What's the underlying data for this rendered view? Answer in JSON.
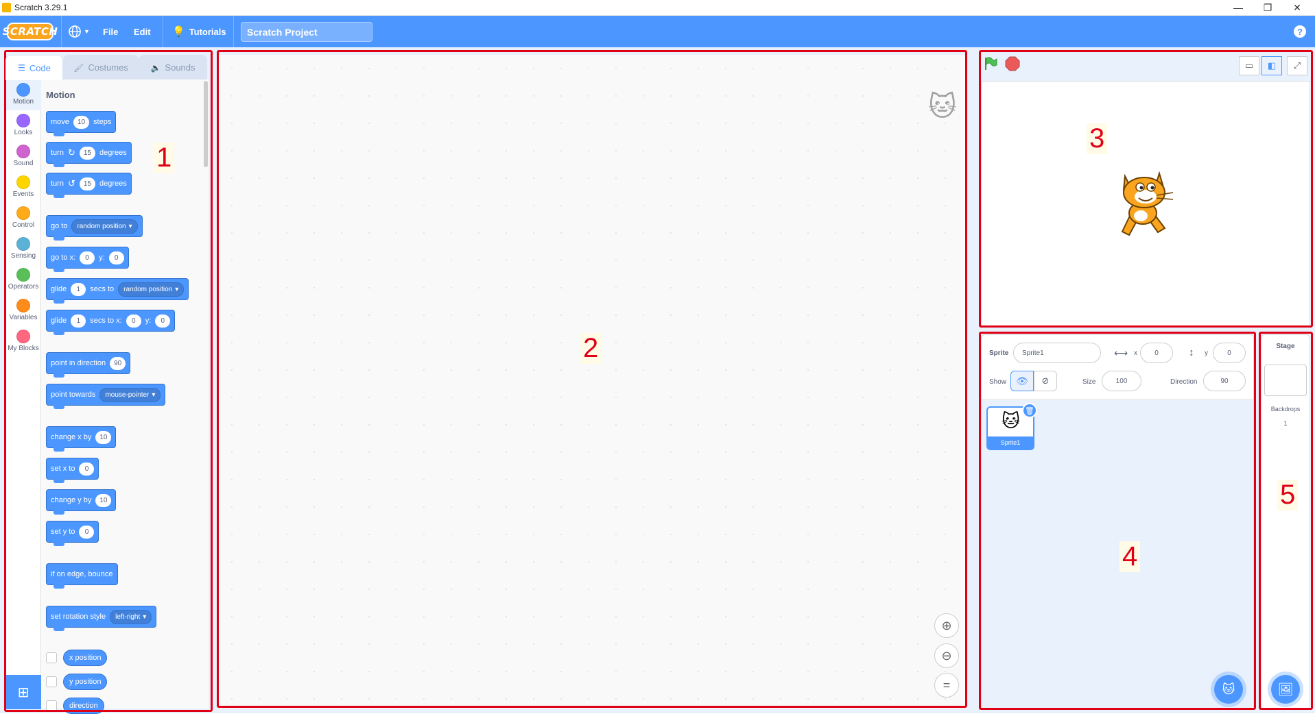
{
  "window": {
    "title": "Scratch 3.29.1",
    "minimize": "—",
    "restore": "❐",
    "close": "✕"
  },
  "menubar": {
    "logo": "SCRATCH",
    "file": "File",
    "edit": "Edit",
    "tutorials": "Tutorials",
    "project_title": "Scratch Project",
    "help": "?"
  },
  "tabs": {
    "code": "Code",
    "costumes": "Costumes",
    "sounds": "Sounds"
  },
  "categories": [
    {
      "label": "Motion",
      "color": "#4c97ff"
    },
    {
      "label": "Looks",
      "color": "#9966ff"
    },
    {
      "label": "Sound",
      "color": "#cf63cf"
    },
    {
      "label": "Events",
      "color": "#ffd500"
    },
    {
      "label": "Control",
      "color": "#ffab19"
    },
    {
      "label": "Sensing",
      "color": "#5cb1d6"
    },
    {
      "label": "Operators",
      "color": "#59c059"
    },
    {
      "label": "Variables",
      "color": "#ff8c1a"
    },
    {
      "label": "My Blocks",
      "color": "#ff6680"
    }
  ],
  "palette": {
    "section_title": "Motion",
    "move": {
      "a": "move",
      "v": "10",
      "b": "steps"
    },
    "turn_right": {
      "a": "turn",
      "v": "15",
      "b": "degrees"
    },
    "turn_left": {
      "a": "turn",
      "v": "15",
      "b": "degrees"
    },
    "go_to": {
      "a": "go to",
      "d": "random position"
    },
    "go_to_xy": {
      "a": "go to x:",
      "x": "0",
      "yl": "y:",
      "y": "0"
    },
    "glide_to": {
      "a": "glide",
      "v": "1",
      "b": "secs to",
      "d": "random position"
    },
    "glide_xy": {
      "a": "glide",
      "v": "1",
      "b": "secs to x:",
      "x": "0",
      "yl": "y:",
      "y": "0"
    },
    "point_dir": {
      "a": "point in direction",
      "v": "90"
    },
    "point_towards": {
      "a": "point towards",
      "d": "mouse-pointer"
    },
    "change_x": {
      "a": "change x by",
      "v": "10"
    },
    "set_x": {
      "a": "set x to",
      "v": "0"
    },
    "change_y": {
      "a": "change y by",
      "v": "10"
    },
    "set_y": {
      "a": "set y to",
      "v": "0"
    },
    "bounce": {
      "a": "if on edge, bounce"
    },
    "rotation": {
      "a": "set rotation style",
      "d": "left-right"
    },
    "x_position": "x position",
    "y_position": "y position",
    "direction": "direction"
  },
  "sprite_info": {
    "sprite_label": "Sprite",
    "sprite_name": "Sprite1",
    "x_label": "x",
    "x_value": "0",
    "y_label": "y",
    "y_value": "0",
    "show_label": "Show",
    "size_label": "Size",
    "size_value": "100",
    "direction_label": "Direction",
    "direction_value": "90"
  },
  "sprites": [
    {
      "name": "Sprite1"
    }
  ],
  "stage_panel": {
    "title": "Stage",
    "backdrops_label": "Backdrops",
    "backdrops_count": "1"
  },
  "annotations": [
    "1",
    "2",
    "3",
    "4",
    "5"
  ]
}
